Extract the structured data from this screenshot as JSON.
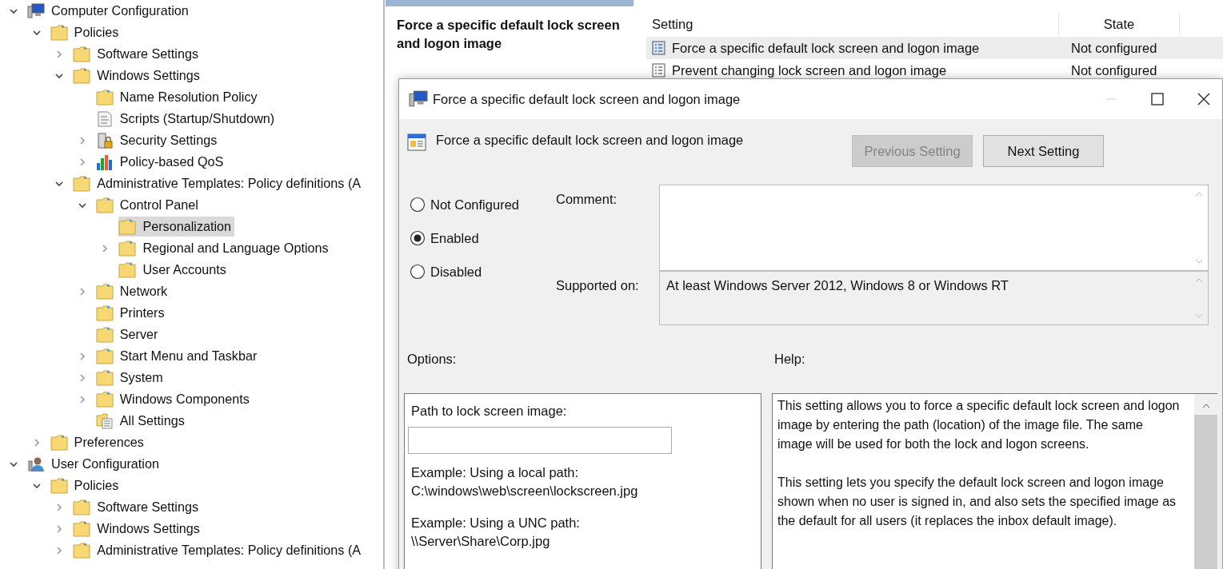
{
  "tree": [
    {
      "label": "Computer Configuration",
      "kind": "computer",
      "expanded": true,
      "selected": false,
      "children": [
        {
          "label": "Policies",
          "kind": "folder",
          "expanded": true,
          "selected": false,
          "children": [
            {
              "label": "Software Settings",
              "kind": "folder",
              "expanded": false,
              "selected": false
            },
            {
              "label": "Windows Settings",
              "kind": "folder",
              "expanded": true,
              "selected": false,
              "children": [
                {
                  "label": "Name Resolution Policy",
                  "kind": "folder",
                  "selected": false
                },
                {
                  "label": "Scripts (Startup/Shutdown)",
                  "kind": "scripts",
                  "selected": false
                },
                {
                  "label": "Security Settings",
                  "kind": "security",
                  "expanded": false,
                  "selected": false
                },
                {
                  "label": "Policy-based QoS",
                  "kind": "qos",
                  "expanded": false,
                  "selected": false
                }
              ]
            },
            {
              "label": "Administrative Templates: Policy definitions (A",
              "kind": "folder",
              "expanded": true,
              "selected": false,
              "children": [
                {
                  "label": "Control Panel",
                  "kind": "folder",
                  "expanded": true,
                  "selected": false,
                  "children": [
                    {
                      "label": "Personalization",
                      "kind": "folder",
                      "selected": true
                    },
                    {
                      "label": "Regional and Language Options",
                      "kind": "folder",
                      "expanded": false,
                      "selected": false
                    },
                    {
                      "label": "User Accounts",
                      "kind": "folder",
                      "selected": false
                    }
                  ]
                },
                {
                  "label": "Network",
                  "kind": "folder",
                  "expanded": false,
                  "selected": false
                },
                {
                  "label": "Printers",
                  "kind": "folder",
                  "selected": false
                },
                {
                  "label": "Server",
                  "kind": "folder",
                  "selected": false
                },
                {
                  "label": "Start Menu and Taskbar",
                  "kind": "folder",
                  "expanded": false,
                  "selected": false
                },
                {
                  "label": "System",
                  "kind": "folder",
                  "expanded": false,
                  "selected": false
                },
                {
                  "label": "Windows Components",
                  "kind": "folder",
                  "expanded": false,
                  "selected": false
                },
                {
                  "label": "All Settings",
                  "kind": "all-settings",
                  "selected": false
                }
              ]
            }
          ]
        },
        {
          "label": "Preferences",
          "kind": "folder",
          "expanded": false,
          "selected": false
        }
      ]
    },
    {
      "label": "User Configuration",
      "kind": "user",
      "expanded": true,
      "selected": false,
      "children": [
        {
          "label": "Policies",
          "kind": "folder",
          "expanded": true,
          "selected": false,
          "children": [
            {
              "label": "Software Settings",
              "kind": "folder",
              "expanded": false,
              "selected": false
            },
            {
              "label": "Windows Settings",
              "kind": "folder",
              "expanded": false,
              "selected": false
            },
            {
              "label": "Administrative Templates: Policy definitions (A",
              "kind": "folder",
              "expanded": false,
              "selected": false
            }
          ]
        }
      ]
    }
  ],
  "details": {
    "title": "Force a specific default lock screen and logon image"
  },
  "settings_list": {
    "columns": [
      "Setting",
      "State"
    ],
    "rows": [
      {
        "setting": "Force a specific default lock screen and logon image",
        "state": "Not configured",
        "selected": true
      },
      {
        "setting": "Prevent changing lock screen and logon image",
        "state": "Not configured",
        "selected": false
      }
    ]
  },
  "dialog": {
    "title": "Force a specific default lock screen and logon image",
    "setting_name": "Force a specific default lock screen and logon image",
    "buttons": [
      {
        "label": "Previous Setting",
        "disabled": true
      },
      {
        "label": "Next Setting",
        "disabled": false
      }
    ],
    "states": [
      {
        "label": "Not Configured",
        "selected": false
      },
      {
        "label": "Enabled",
        "selected": true
      },
      {
        "label": "Disabled",
        "selected": false
      }
    ],
    "comment_label": "Comment:",
    "supported_label": "Supported on:",
    "supported_value": "At least Windows Server 2012, Windows 8 or Windows RT",
    "options_label": "Options:",
    "help_label": "Help:",
    "path_label": "Path to lock screen image:",
    "examples": [
      {
        "caption": "Example: Using a local path:",
        "path": "C:\\windows\\web\\screen\\lockscreen.jpg"
      },
      {
        "caption": "Example: Using a UNC path:",
        "path": "\\\\Server\\Share\\Corp.jpg"
      }
    ],
    "help": [
      "This setting allows you to force a specific default lock screen and logon image by entering the path (location) of the image file. The same image will be used for both the lock and logon screens.",
      "This setting lets you specify the default lock screen and logon image shown when no user is signed in, and also sets the specified image as the default for all users (it replaces the inbox default image)."
    ]
  }
}
